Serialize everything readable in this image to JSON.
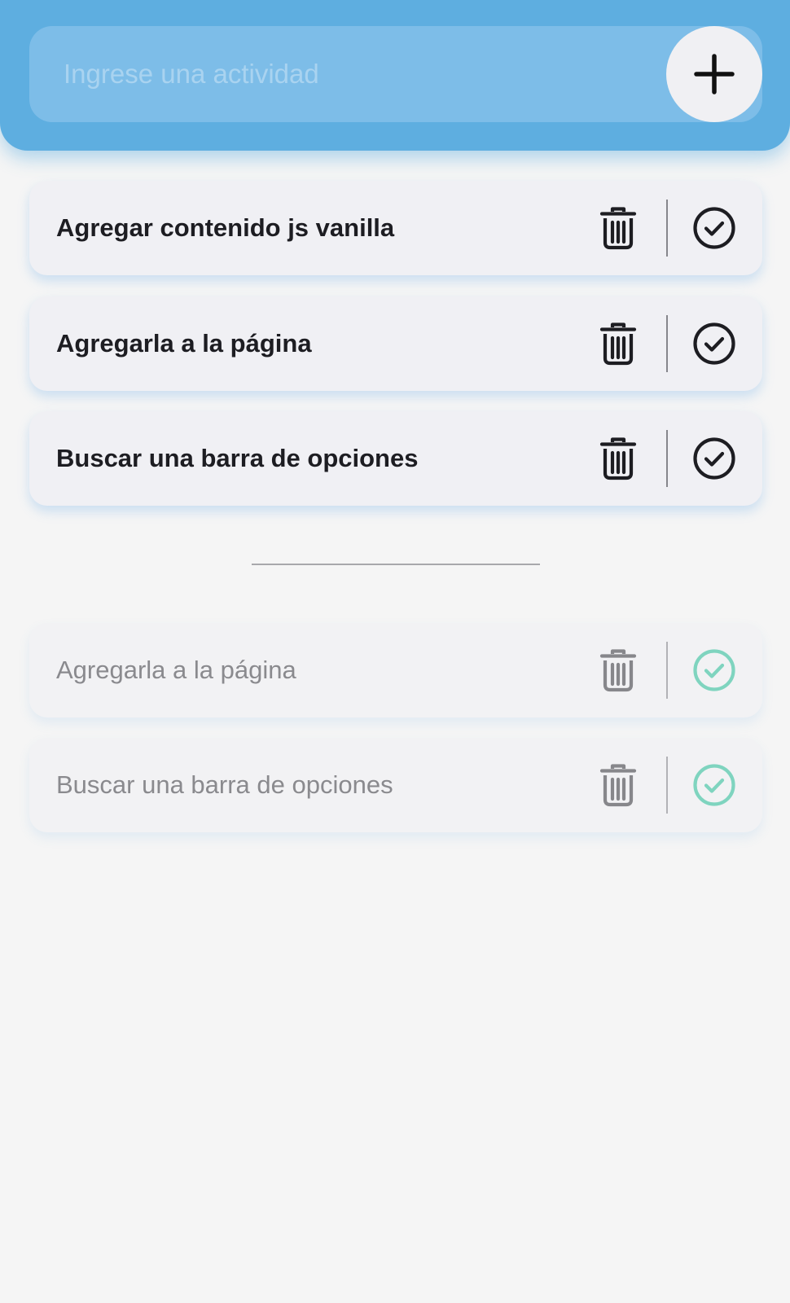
{
  "input": {
    "placeholder": "Ingrese una actividad",
    "value": ""
  },
  "add_button": {
    "icon": "plus-icon"
  },
  "pending_tasks": [
    {
      "label": "Agregar contenido js vanilla"
    },
    {
      "label": "Agregarla a la página"
    },
    {
      "label": "Buscar una barra de opciones"
    }
  ],
  "completed_tasks": [
    {
      "label": "Agregarla a la página"
    },
    {
      "label": "Buscar una barra de opciones"
    }
  ],
  "icons": {
    "delete": "trash-icon",
    "complete": "check-circle-icon"
  },
  "colors": {
    "header": "#5eaee0",
    "input_bg": "#7dbde8",
    "placeholder": "#a9d3f0",
    "card_bg": "#f0f0f4",
    "page_bg": "#f5f5f5",
    "pending_icon": "#1d1d22",
    "completed_text": "#8a8a8e",
    "completed_check": "#7fd4bf"
  }
}
